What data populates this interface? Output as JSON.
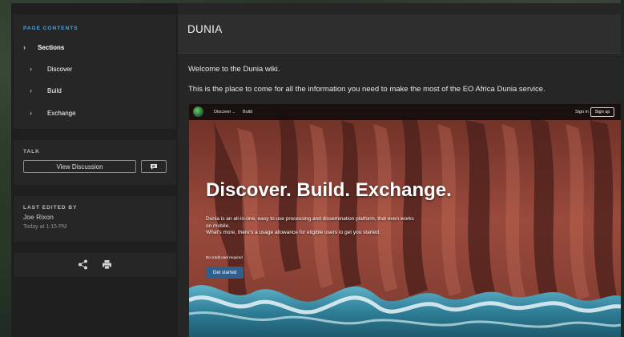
{
  "sidebar": {
    "contents": {
      "label": "PAGE CONTENTS",
      "top_item": "Sections",
      "items": [
        {
          "label": "Discover"
        },
        {
          "label": "Build"
        },
        {
          "label": "Exchange"
        }
      ]
    },
    "talk": {
      "label": "TALK",
      "view_discussion": "View Discussion"
    },
    "edited": {
      "label": "LAST EDITED BY",
      "name": "Joe Rixon",
      "time": "Today at 1:15 PM"
    },
    "icons": [
      "share-icon",
      "print-icon"
    ]
  },
  "main": {
    "title": "DUNIA",
    "intro": "Welcome to the Dunia wiki.",
    "body": "This is the place to come for all the information you need to make the most of the EO Africa Dunia service.",
    "screenshot": {
      "nav": [
        "Discover",
        "Build"
      ],
      "sign_in": "Sign in",
      "sign_up": "Sign up",
      "hero": "Discover. Build. Exchange.",
      "desc1": "Dunia is an all-in-one, easy to use processing and dissemination platform, that even works on mobile.",
      "desc2": "What's more, there's a usage allowance for eligible users to get you started.",
      "no_card": "No credit card required",
      "cta": "Get started"
    }
  },
  "colors": {
    "accent": "#4aa3df",
    "panel": "#262626",
    "cta": "#2f5f8c"
  }
}
